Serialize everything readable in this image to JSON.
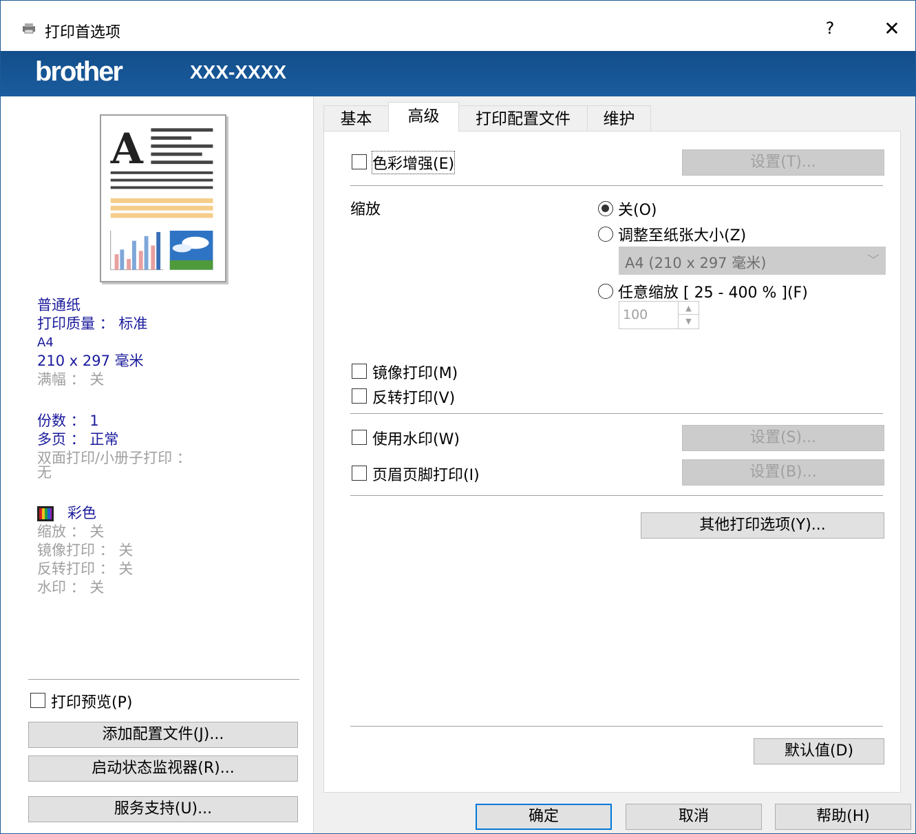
{
  "window": {
    "title": "打印首选项",
    "help": "?",
    "close": "✕"
  },
  "banner": {
    "logo": "brother",
    "model": "XXX-XXXX"
  },
  "summary": {
    "paper_type": "普通纸",
    "print_quality": "打印质量 ： 标准",
    "paper_size": "A4",
    "paper_dims": "210 x 297 毫米",
    "borderless": "满幅 ： 关",
    "copies": "份数 ： 1",
    "multipage": "多页 ： 正常",
    "duplex": "双面打印/小册子打印 ：",
    "duplex_value": "无",
    "color_mode": "彩色",
    "scaling": "缩放 ： 关",
    "mirror": "镜像打印 ： 关",
    "reverse": "反转打印 ： 关",
    "watermark": "水印 ： 关"
  },
  "left_actions": {
    "print_preview": "打印预览(P)",
    "add_profile": "添加配置文件(J)...",
    "status_monitor": "启动状态监视器(R)...",
    "support": "服务支持(U)..."
  },
  "tabs": [
    "基本",
    "高级",
    "打印配置文件",
    "维护"
  ],
  "advanced": {
    "color_enhance": "色彩增强(E)",
    "color_settings": "设置(T)...",
    "scaling_label": "缩放",
    "scale_off": "关(O)",
    "scale_fit": "调整至纸张大小(Z)",
    "paper_select": "A4 (210 x 297 毫米)",
    "scale_free": "任意缩放 [ 25 - 400 % ](F)",
    "scale_value": "100",
    "mirror_print": "镜像打印(M)",
    "reverse_print": "反转打印(V)",
    "watermark": "使用水印(W)",
    "watermark_settings": "设置(S)...",
    "header_footer": "页眉页脚打印(I)",
    "header_footer_settings": "设置(B)...",
    "other_options": "其他打印选项(Y)...",
    "defaults": "默认值(D)"
  },
  "footer": {
    "ok": "确定",
    "cancel": "取消",
    "help": "帮助(H)"
  }
}
